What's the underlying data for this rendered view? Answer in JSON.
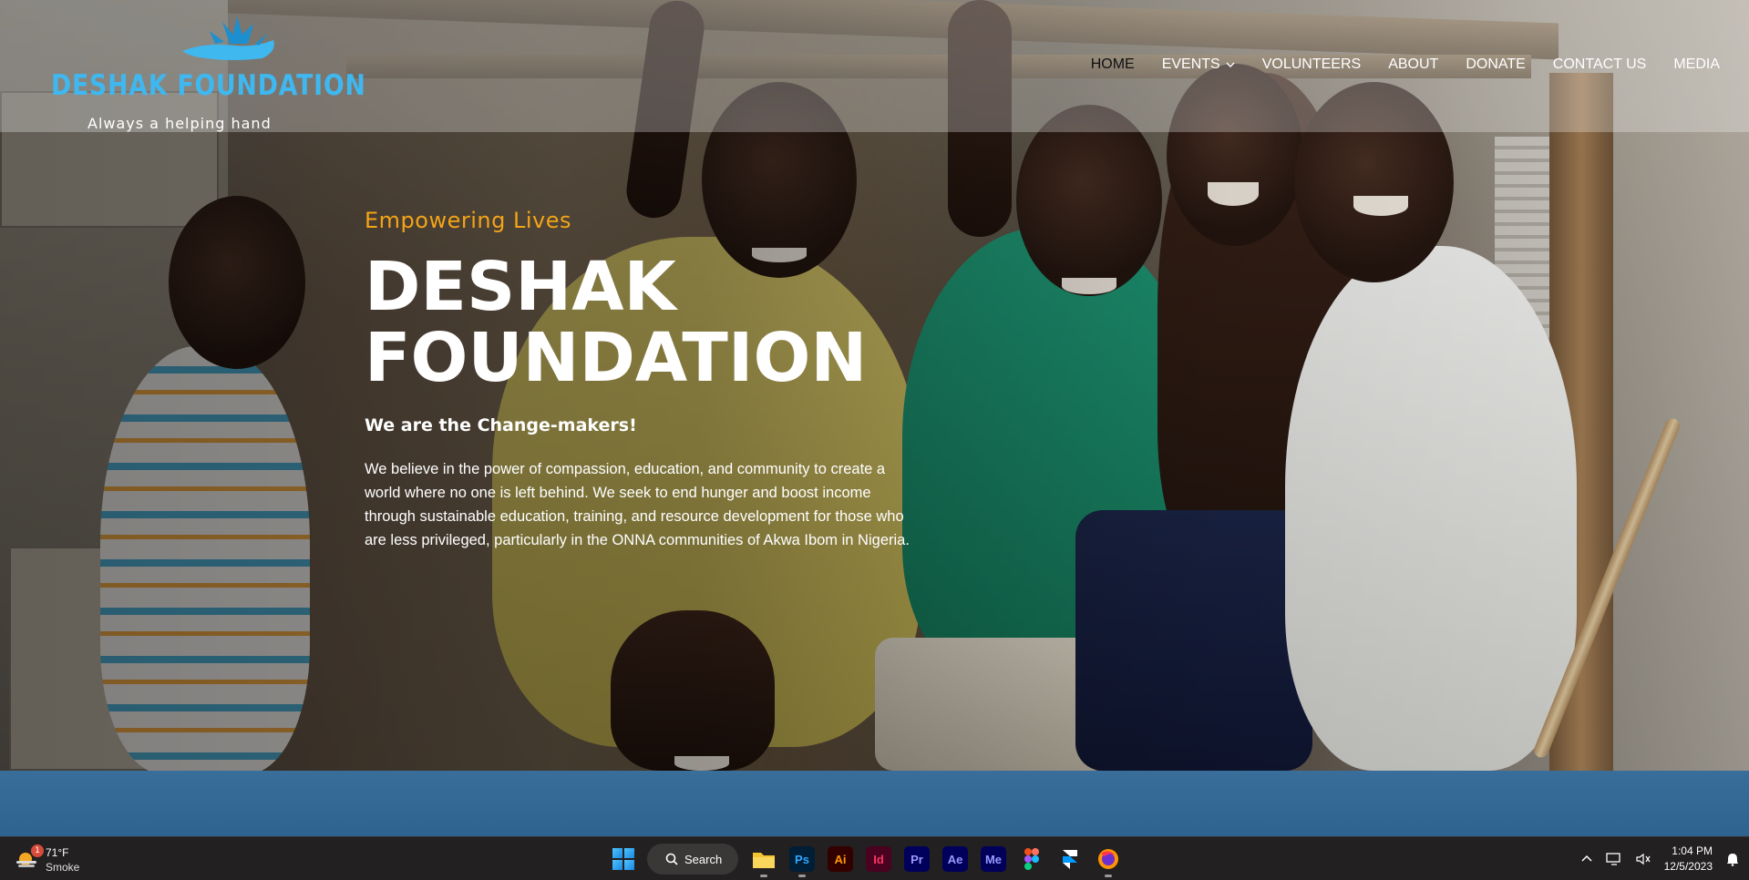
{
  "header": {
    "logo": {
      "name": "DESHAK FOUNDATION",
      "tagline": "Always a helping hand"
    },
    "nav": [
      {
        "label": "HOME",
        "active": true
      },
      {
        "label": "EVENTS",
        "has_dropdown": true
      },
      {
        "label": "VOLUNTEERS"
      },
      {
        "label": "ABOUT"
      },
      {
        "label": "DONATE"
      },
      {
        "label": "CONTACT US"
      },
      {
        "label": "MEDIA"
      }
    ]
  },
  "hero": {
    "kicker": "Empowering Lives",
    "headline_line1": "DESHAK",
    "headline_line2": "FOUNDATION",
    "subhead": "We are the Change-makers!",
    "body": "We believe in the power of compassion, education, and community to create a world where no one is left behind. We seek to end hunger and boost income through sustainable education, training, and resource development for those who are less privileged, particularly in the ONNA communities of Akwa Ibom in Nigeria."
  },
  "taskbar": {
    "weather": {
      "temp": "71°F",
      "condition": "Smoke",
      "badge": "1"
    },
    "search_label": "Search",
    "apps": [
      {
        "name": "file-explorer",
        "label": ""
      },
      {
        "name": "photoshop",
        "label": "Ps"
      },
      {
        "name": "illustrator",
        "label": "Ai"
      },
      {
        "name": "indesign",
        "label": "Id"
      },
      {
        "name": "premiere-pro",
        "label": "Pr"
      },
      {
        "name": "after-effects",
        "label": "Ae"
      },
      {
        "name": "media-encoder",
        "label": "Me"
      },
      {
        "name": "figma",
        "label": ""
      },
      {
        "name": "framer",
        "label": ""
      },
      {
        "name": "firefox",
        "label": ""
      }
    ],
    "clock": {
      "time": "1:04 PM",
      "date": "12/5/2023"
    }
  },
  "colors": {
    "accent_orange": "#f3a417",
    "logo_blue": "#3fb7ef",
    "band_blue": "#2f638f"
  }
}
